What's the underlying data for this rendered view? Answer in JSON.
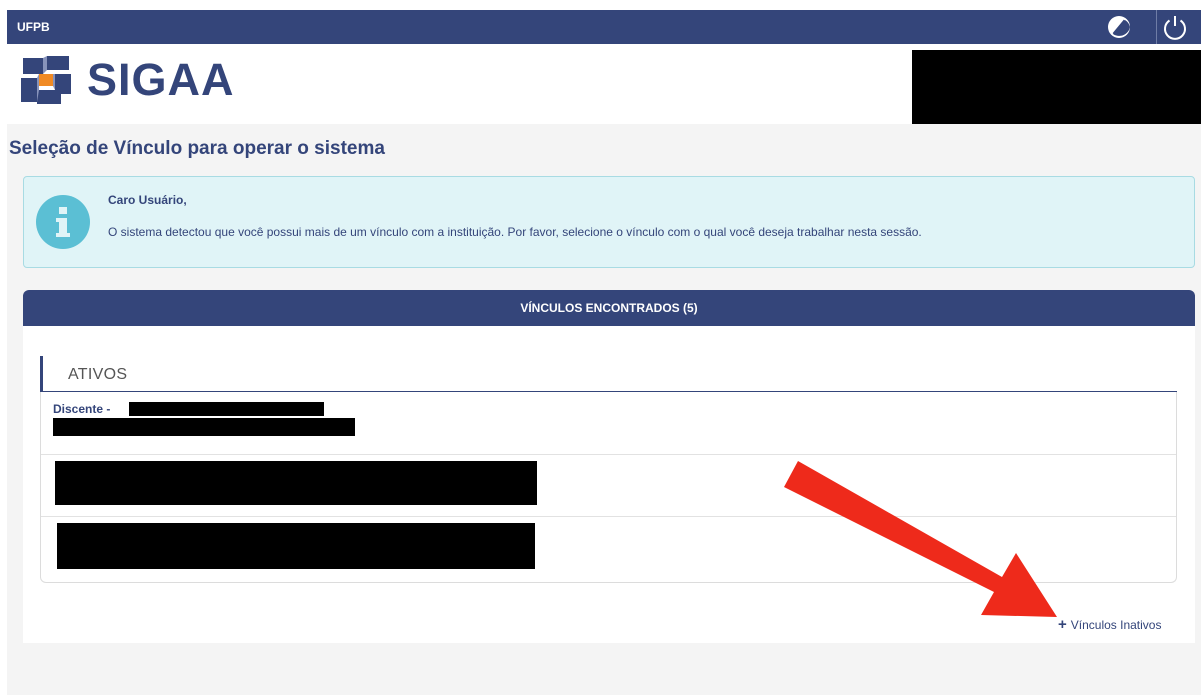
{
  "topbar": {
    "org": "UFPB"
  },
  "header": {
    "logo_text": "SIGAA"
  },
  "page": {
    "title": "Seleção de Vínculo para operar o sistema"
  },
  "info": {
    "title": "Caro Usuário,",
    "text": "O sistema detectou que você possui mais de um vínculo com a instituição. Por favor, selecione o vínculo com o qual você deseja trabalhar nesta sessão."
  },
  "panel": {
    "header": "VÍNCULOS ENCONTRADOS (5)",
    "group_title": "ATIVOS",
    "rows": [
      {
        "label": "Discente -"
      }
    ]
  },
  "links": {
    "inactive": "Vínculos Inativos"
  },
  "colors": {
    "primary": "#34457a",
    "info_bg": "#e0f4f7",
    "info_icon": "#5bbfd4",
    "arrow": "#ee2a1b"
  },
  "icons": [
    "contrast-icon",
    "power-icon",
    "info-icon",
    "plus-icon",
    "sigaa-logo-icon"
  ]
}
